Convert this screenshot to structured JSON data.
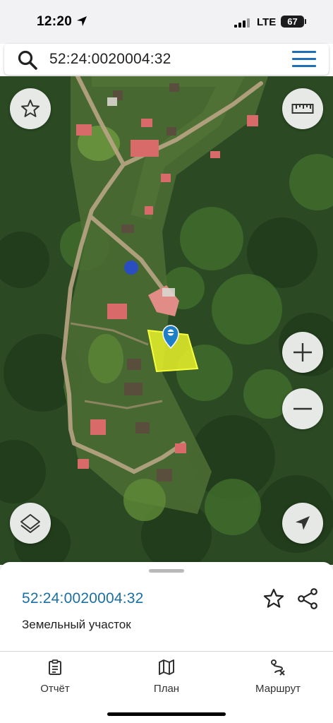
{
  "status_bar": {
    "time": "12:20",
    "network": "LTE",
    "battery": "67"
  },
  "search": {
    "query": "52:24:0020004:32"
  },
  "map": {
    "parcel_color": "#e9f22a",
    "marker_color": "#1f7fc6",
    "buttons": {
      "favorite": "star-icon",
      "ruler": "ruler-icon",
      "zoom_in": "plus-icon",
      "zoom_out": "minus-icon",
      "layers": "layers-icon",
      "location": "navigation-arrow-icon"
    }
  },
  "sheet": {
    "cadastral_number": "52:24:0020004:32",
    "object_type": "Земельный участок"
  },
  "tabs": [
    {
      "label": "Отчёт",
      "icon": "clipboard-icon"
    },
    {
      "label": "План",
      "icon": "map-icon"
    },
    {
      "label": "Маршрут",
      "icon": "route-icon"
    }
  ],
  "colors": {
    "accent": "#1a6fa5",
    "menu": "#1e6eb8"
  }
}
